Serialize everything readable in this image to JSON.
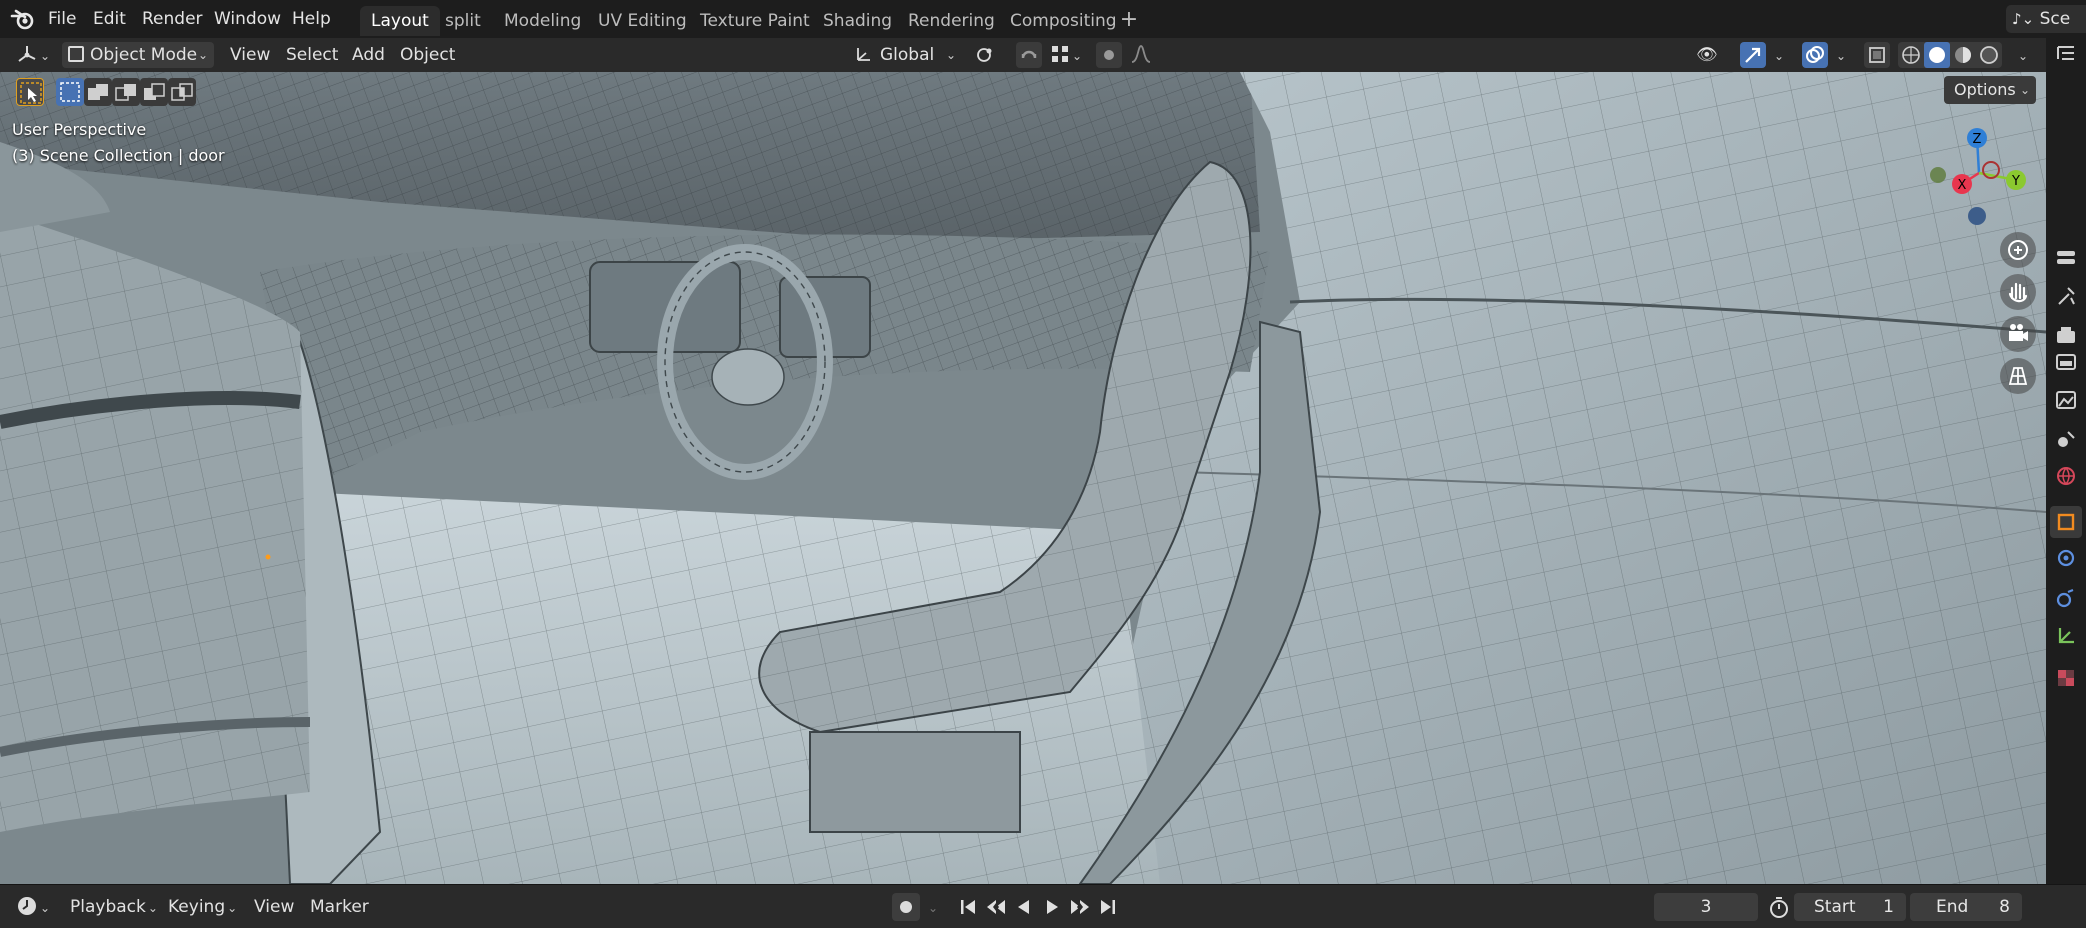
{
  "menu": {
    "items": [
      "File",
      "Edit",
      "Render",
      "Window",
      "Help"
    ]
  },
  "workspaces": {
    "tabs": [
      "Layout",
      "split",
      "Modeling",
      "UV Editing",
      "Texture Paint",
      "Shading",
      "Rendering",
      "Compositing"
    ],
    "active": "Layout",
    "add_label": "+"
  },
  "scene_selector": {
    "label": "Sce"
  },
  "viewport_header": {
    "mode": "Object Mode",
    "menus": [
      "View",
      "Select",
      "Add",
      "Object"
    ],
    "transform_orientation": "Global"
  },
  "viewport": {
    "perspective_label": "User Perspective",
    "collection_label": "(3) Scene Collection | door",
    "options_label": "Options",
    "gizmo_axes": {
      "z": "Z",
      "x": "X",
      "y": "Y"
    }
  },
  "timeline": {
    "menus": [
      "Playback",
      "Keying",
      "View",
      "Marker"
    ],
    "current_frame": "3",
    "start_label": "Start",
    "start_value": "1",
    "end_label": "End",
    "end_value": "8"
  },
  "colors": {
    "accent_blue": "#4772b3",
    "axis_x": "#e8364e",
    "axis_y": "#8bc92f",
    "axis_z": "#2f7fd6"
  }
}
